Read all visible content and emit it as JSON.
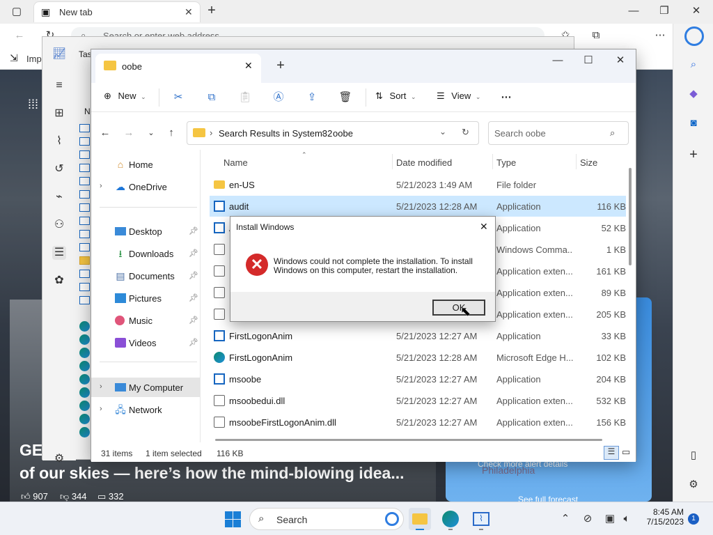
{
  "edge": {
    "tab_title": "New tab",
    "address_placeholder": "Search or enter web address",
    "fav_items": [
      "Impo",
      "Tas"
    ],
    "news_headline_1": "GE has a",
    "news_headline_2": "of our skies — here’s how the mind-blowing idea...",
    "reactions": {
      "likes": "907",
      "dislikes": "344",
      "comments": "332"
    },
    "alert_text": "Check more alert details",
    "weather_city": "Philadelphia",
    "forecast_link": "See full forecast"
  },
  "explorer": {
    "tab_title": "oobe",
    "commands": {
      "new": "New",
      "sort": "Sort",
      "view": "View"
    },
    "breadcrumb": [
      "Search Results in System32",
      "oobe"
    ],
    "search_placeholder": "Search oobe",
    "nav": {
      "home": "Home",
      "onedrive": "OneDrive",
      "desktop": "Desktop",
      "downloads": "Downloads",
      "documents": "Documents",
      "pictures": "Pictures",
      "music": "Music",
      "videos": "Videos",
      "my_computer": "My Computer",
      "network": "Network"
    },
    "columns": {
      "name": "Name",
      "date": "Date modified",
      "type": "Type",
      "size": "Size"
    },
    "rows": [
      {
        "name": "en-US",
        "date": "5/21/2023 1:49 AM",
        "type": "File folder",
        "size": "",
        "icon": "folder"
      },
      {
        "name": "audit",
        "date": "5/21/2023 12:28 AM",
        "type": "Application",
        "size": "116 KB",
        "icon": "app"
      },
      {
        "name": "A",
        "date": "",
        "type": "Application",
        "size": "52 KB",
        "icon": "app"
      },
      {
        "name": "E",
        "date": "",
        "type": "Windows Comma...",
        "size": "1 KB",
        "icon": "dll"
      },
      {
        "name": "",
        "date": "",
        "type": "Application exten...",
        "size": "161 KB",
        "icon": "dll"
      },
      {
        "name": "",
        "date": "",
        "type": "Application exten...",
        "size": "89 KB",
        "icon": "dll"
      },
      {
        "name": "",
        "date": "",
        "type": "Application exten...",
        "size": "205 KB",
        "icon": "dll"
      },
      {
        "name": "FirstLogonAnim",
        "date": "5/21/2023 12:27 AM",
        "type": "Application",
        "size": "33 KB",
        "icon": "app"
      },
      {
        "name": "FirstLogonAnim",
        "date": "5/21/2023 12:28 AM",
        "type": "Microsoft Edge H...",
        "size": "102 KB",
        "icon": "edge"
      },
      {
        "name": "msoobe",
        "date": "5/21/2023 12:27 AM",
        "type": "Application",
        "size": "204 KB",
        "icon": "app"
      },
      {
        "name": "msoobedui.dll",
        "date": "5/21/2023 12:27 AM",
        "type": "Application exten...",
        "size": "532 KB",
        "icon": "dll"
      },
      {
        "name": "msoobeFirstLogonAnim.dll",
        "date": "5/21/2023 12:27 AM",
        "type": "Application exten...",
        "size": "156 KB",
        "icon": "dll"
      }
    ],
    "status": {
      "count": "31 items",
      "selected": "1 item selected",
      "size": "116 KB"
    }
  },
  "dialog": {
    "title": "Install Windows",
    "message_1": "Windows could not complete the installation. To install",
    "message_2": "Windows on this computer, restart the installation.",
    "ok": "OK"
  },
  "taskbar": {
    "search": "Search",
    "time": "8:45 AM",
    "date": "7/15/2023",
    "notification_count": "1"
  }
}
